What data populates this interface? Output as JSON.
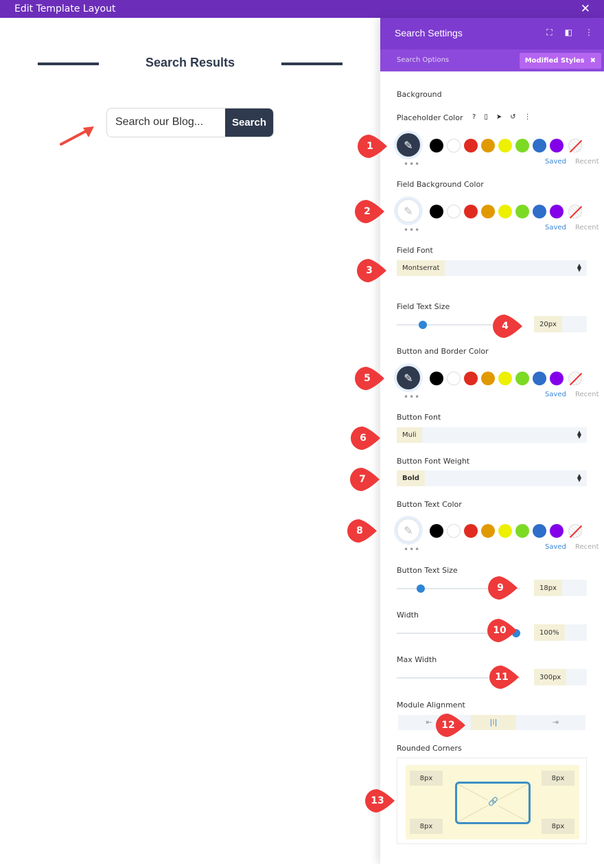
{
  "window": {
    "title": "Edit Template Layout",
    "close_icon": "close-icon"
  },
  "canvas": {
    "heading": "Search Results",
    "search_placeholder": "Search our Blog...",
    "search_button": "Search"
  },
  "panel": {
    "title": "Search Settings",
    "tabs": {
      "options": "Search Options",
      "modified": "Modified Styles"
    },
    "section": "Background",
    "placeholder_color": {
      "label": "Placeholder Color",
      "help": "?"
    },
    "swatch_colors": [
      "#000000",
      "#ffffff",
      "#e02b20",
      "#e09900",
      "#edf000",
      "#7cda24",
      "#2f6ec9",
      "#8300e9"
    ],
    "saved": "Saved",
    "recent": "Recent",
    "field_bg_color": {
      "label": "Field Background Color"
    },
    "field_font": {
      "label": "Field Font",
      "value": "Montserrat"
    },
    "field_text_size": {
      "label": "Field Text Size",
      "value": "20px"
    },
    "button_border_color": {
      "label": "Button and Border Color"
    },
    "button_font": {
      "label": "Button Font",
      "value": "Muli"
    },
    "button_font_weight": {
      "label": "Button Font Weight",
      "value": "Bold"
    },
    "button_text_color": {
      "label": "Button Text Color"
    },
    "button_text_size": {
      "label": "Button Text Size",
      "value": "18px"
    },
    "width": {
      "label": "Width",
      "value": "100%"
    },
    "max_width": {
      "label": "Max Width",
      "value": "300px"
    },
    "module_alignment": {
      "label": "Module Alignment"
    },
    "rounded_corners": {
      "label": "Rounded Corners",
      "tl": "8px",
      "tr": "8px",
      "bl": "8px",
      "br": "8px"
    }
  },
  "markers": [
    "1",
    "2",
    "3",
    "4",
    "5",
    "6",
    "7",
    "8",
    "9",
    "10",
    "11",
    "12",
    "13"
  ],
  "colors": {
    "accent": "#7e3bd0",
    "marker": "#ee3a3a",
    "dark": "#2f3a4e"
  }
}
